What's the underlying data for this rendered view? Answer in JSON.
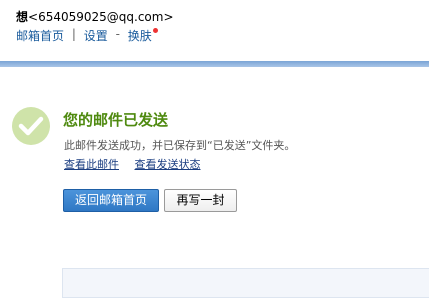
{
  "header": {
    "user_name": "想",
    "user_email": "<654059025@qq.com>",
    "nav": {
      "home_label": "邮箱首页",
      "separator1": "|",
      "settings_label": "设置",
      "separator2": "-",
      "skin_label": "换肤"
    }
  },
  "result": {
    "title": "您的邮件已发送",
    "description": "此邮件发送成功，并已保存到“已发送”文件夹。",
    "view_mail_link": "查看此邮件",
    "view_status_link": "查看发送状态"
  },
  "actions": {
    "back_home_label": "返回邮箱首页",
    "write_again_label": "再写一封"
  },
  "colors": {
    "title_green": "#4f8a10",
    "link_blue": "#1a5b9c",
    "primary_button": "#2f78c4",
    "notification_dot": "#e33333"
  }
}
